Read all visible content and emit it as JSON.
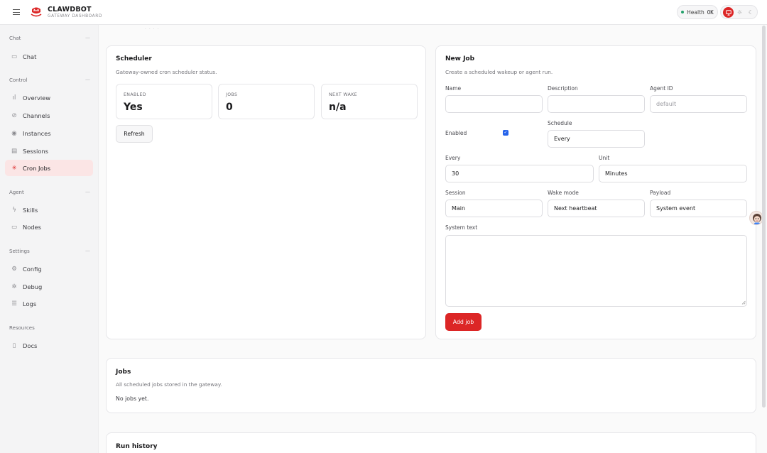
{
  "app": {
    "title": "CLAWDBOT",
    "subtitle": "GATEWAY DASHBOARD",
    "health_label": "Health",
    "health_value": "OK",
    "theme_icons": [
      "monitor-icon",
      "sun-icon",
      "moon-icon"
    ]
  },
  "sidebar": {
    "groups": [
      {
        "label": "Chat",
        "items": [
          {
            "label": "Chat",
            "icon": "chat-icon"
          }
        ]
      },
      {
        "label": "Control",
        "items": [
          {
            "label": "Overview",
            "icon": "bar-chart-icon"
          },
          {
            "label": "Channels",
            "icon": "link-icon"
          },
          {
            "label": "Instances",
            "icon": "radio-icon"
          },
          {
            "label": "Sessions",
            "icon": "file-icon"
          },
          {
            "label": "Cron Jobs",
            "icon": "loader-icon",
            "active": true
          }
        ]
      },
      {
        "label": "Agent",
        "items": [
          {
            "label": "Skills",
            "icon": "zap-icon"
          },
          {
            "label": "Nodes",
            "icon": "monitor-icon"
          }
        ]
      },
      {
        "label": "Settings",
        "items": [
          {
            "label": "Config",
            "icon": "gear-icon"
          },
          {
            "label": "Debug",
            "icon": "bug-icon"
          },
          {
            "label": "Logs",
            "icon": "scroll-icon"
          }
        ]
      },
      {
        "label": "Resources",
        "items": [
          {
            "label": "Docs",
            "icon": "book-icon"
          }
        ]
      }
    ]
  },
  "scheduler": {
    "title": "Scheduler",
    "subtitle": "Gateway-owned cron scheduler status.",
    "stats": [
      {
        "label": "ENABLED",
        "value": "Yes"
      },
      {
        "label": "JOBS",
        "value": "0"
      },
      {
        "label": "NEXT WAKE",
        "value": "n/a"
      }
    ],
    "refresh_label": "Refresh"
  },
  "new_job": {
    "title": "New Job",
    "subtitle": "Create a scheduled wakeup or agent run.",
    "name_label": "Name",
    "name_value": "",
    "description_label": "Description",
    "description_value": "",
    "agent_id_label": "Agent ID",
    "agent_id_placeholder": "default",
    "enabled_label": "Enabled",
    "enabled_checked": true,
    "schedule_label": "Schedule",
    "schedule_value": "Every",
    "every_label": "Every",
    "every_value": "30",
    "unit_label": "Unit",
    "unit_value": "Minutes",
    "session_label": "Session",
    "session_value": "Main",
    "wake_mode_label": "Wake mode",
    "wake_mode_value": "Next heartbeat",
    "payload_label": "Payload",
    "payload_value": "System event",
    "system_text_label": "System text",
    "system_text_value": "",
    "add_job_label": "Add job"
  },
  "jobs": {
    "title": "Jobs",
    "subtitle": "All scheduled jobs stored in the gateway.",
    "empty_text": "No jobs yet."
  },
  "run_history": {
    "title": "Run history"
  },
  "colors": {
    "accent": "#dc2626",
    "active_bg": "#fbe5e5",
    "health_dot": "#22a06b",
    "checkbox": "#2563eb"
  }
}
